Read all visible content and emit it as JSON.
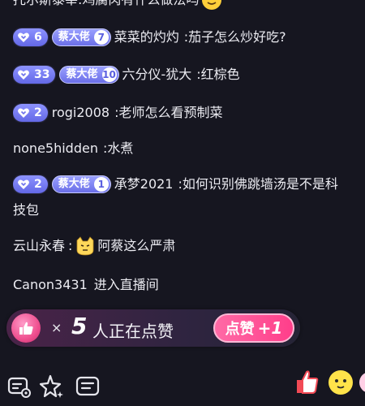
{
  "chat": {
    "messages": [
      {
        "user": "托尔斯泰莘",
        "text": ":鸡腐肉有什么做法吗"
      },
      {
        "level": "6",
        "fan_badge": "蔡大佬",
        "fan_level": "7",
        "user": "菜菜的灼灼",
        "text": ":茄子怎么炒好吃?"
      },
      {
        "level": "33",
        "fan_badge": "蔡大佬",
        "fan_level": "10",
        "user": "六分仪-犹大",
        "text": ":红棕色"
      },
      {
        "level": "2",
        "user": "rogi2008",
        "text": ":老师怎么看预制菜"
      },
      {
        "user": "none5hidden",
        "text": ":水煮"
      },
      {
        "level": "2",
        "fan_badge": "蔡大佬",
        "fan_level": "1",
        "user": "承梦2021",
        "text": ":如何识别佛跳墙汤是不是科",
        "continuation": "技包"
      },
      {
        "user": "云山永春",
        "text_before": ":",
        "text": "阿蔡这么严肃"
      },
      {
        "user": "Canon3431",
        "text": "进入直播间"
      }
    ]
  },
  "likes_bar": {
    "times": "×",
    "count": "5",
    "label": "人正在点赞",
    "button_label": "点赞",
    "button_plus": "+1"
  },
  "colors": {
    "background": "#161620",
    "level_badge": "#7277f0",
    "like_pink": "#ff4a8f"
  },
  "icons": [
    "level-heart-icon",
    "thumbs-up-icon",
    "comment-settings-icon",
    "sparkle-star-icon",
    "chat-list-icon",
    "gift-thumbs-icon",
    "gift-face-icon"
  ]
}
